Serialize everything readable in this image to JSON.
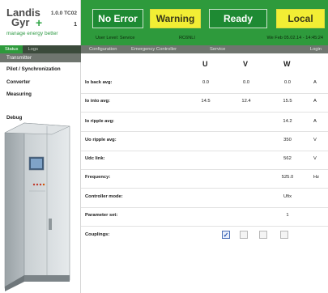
{
  "logo": {
    "line1": "Landis",
    "line2": "Gyr",
    "plus": "+",
    "slogan": "manage energy better"
  },
  "version": "1.0.0 TC02",
  "unit_number": "1",
  "status": {
    "error_label": "No Error",
    "warning_label": "Warning",
    "ready_label": "Ready",
    "local_label": "Local"
  },
  "info": {
    "level": "User Level: Service",
    "user": "RC6NLI",
    "datetime": "We Feb 05.02.14 - 14:45:24"
  },
  "nav_left": [
    {
      "label": "Status",
      "active": true
    },
    {
      "label": "Logs",
      "active": false
    }
  ],
  "nav_right": {
    "configuration": "Configuration",
    "emergency": "Emergency Controller",
    "service": "Service",
    "login": "Login"
  },
  "sidebar": {
    "items": [
      {
        "label": "Transmitter",
        "selected": true
      },
      {
        "label": "Pilot / Synchronization",
        "selected": false
      },
      {
        "label": "Converter",
        "selected": false
      },
      {
        "label": "Measuring",
        "selected": false
      },
      {
        "label": "Debug",
        "selected": false
      }
    ]
  },
  "columns": {
    "u": "U",
    "v": "V",
    "w": "W"
  },
  "rows": {
    "io_back": {
      "label": "Io back avg:",
      "u": "0.0",
      "v": "0.0",
      "w": "0.0",
      "unit": "A"
    },
    "io_into": {
      "label": "Io into avg:",
      "u": "14.5",
      "v": "12.4",
      "w": "15.5",
      "unit": "A"
    },
    "io_ripple": {
      "label": "Io ripple avg:",
      "value": "14.2",
      "unit": "A"
    },
    "uo_ripple": {
      "label": "Uo ripple avg:",
      "value": "350",
      "unit": "V"
    },
    "udc_link": {
      "label": "Udc link:",
      "value": "562",
      "unit": "V"
    },
    "frequency": {
      "label": "Frequency:",
      "value": "525.0",
      "unit": "Hz"
    },
    "controller_mode": {
      "label": "Controller mode:",
      "value": "Ufix"
    },
    "parameter_set": {
      "label": "Parameter set:",
      "value": "1"
    },
    "couplings": {
      "label": "Couplings:",
      "checkboxes": [
        true,
        false,
        false,
        false
      ]
    }
  },
  "colors": {
    "brand_green": "#2e9a3c",
    "status_yellow": "#f2ee34",
    "nav_grey": "#6f756f"
  }
}
